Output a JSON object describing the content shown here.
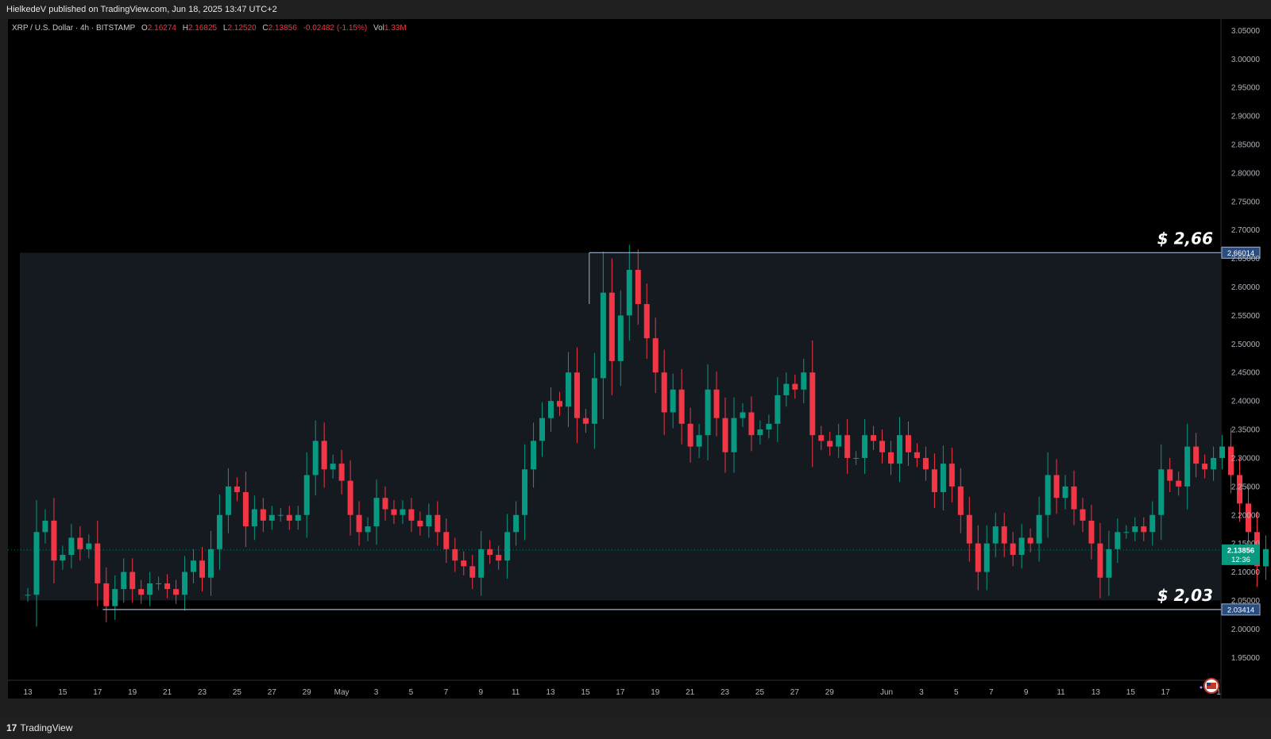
{
  "header": {
    "published": "HielkedeV published on TradingView.com, Jun 18, 2025 13:47 UTC+2"
  },
  "legend": {
    "symbol": "XRP / U.S. Dollar · 4h · BITSTAMP",
    "open_label": "O",
    "open": "2.16274",
    "high_label": "H",
    "high": "2.16825",
    "low_label": "L",
    "low": "2.12520",
    "close_label": "C",
    "close": "2.13856",
    "change": "-0.02482 (-1.15%)",
    "vol_label": "Vol",
    "vol": "1.33M"
  },
  "footer": {
    "logo_mark": "17",
    "logo_text": "TradingView"
  },
  "colors": {
    "up": "#089981",
    "down": "#f23645",
    "bg": "#000000",
    "zone": "#141a20",
    "level_line": "#9fb4cc",
    "accent_badge": "#2b4c7e",
    "price_badge": "#089981"
  },
  "chart_data": {
    "type": "candlestick",
    "interval": "4h",
    "ylim": [
      1.91,
      3.07
    ],
    "y_ticks": [
      "3.05000",
      "3.00000",
      "2.95000",
      "2.90000",
      "2.85000",
      "2.80000",
      "2.75000",
      "2.70000",
      "2.65000",
      "2.60000",
      "2.55000",
      "2.50000",
      "2.45000",
      "2.40000",
      "2.35000",
      "2.30000",
      "2.25000",
      "2.20000",
      "2.15000",
      "2.10000",
      "2.05000",
      "2.00000",
      "1.95000"
    ],
    "x_ticks": [
      "13",
      "15",
      "17",
      "19",
      "21",
      "23",
      "25",
      "27",
      "29",
      "May",
      "3",
      "5",
      "7",
      "9",
      "11",
      "13",
      "15",
      "17",
      "19",
      "21",
      "23",
      "25",
      "27",
      "29",
      "Jun",
      "3",
      "5",
      "7",
      "9",
      "11",
      "13",
      "15",
      "17",
      "1"
    ],
    "range_zone": {
      "top": 2.66,
      "bottom": 2.05,
      "from": "Apr 12",
      "to": "Jun 18"
    },
    "levels": [
      {
        "value": 2.66014,
        "label": "$ 2,66",
        "badge": "2.66014",
        "from": "May 12"
      },
      {
        "value": 2.03414,
        "label": "$ 2,03",
        "badge": "2.03414",
        "from": "Apr 16"
      }
    ],
    "last_price": {
      "value": 2.13856,
      "badge": "2.13856",
      "countdown": "12:36"
    },
    "series": [
      {
        "d": 0,
        "c": 2.06
      },
      {
        "d": 0.5,
        "c": 2.17
      },
      {
        "d": 1,
        "c": 2.19
      },
      {
        "d": 1.5,
        "c": 2.12
      },
      {
        "d": 2,
        "c": 2.13
      },
      {
        "d": 2.5,
        "c": 2.16
      },
      {
        "d": 3,
        "c": 2.14
      },
      {
        "d": 3.5,
        "c": 2.15
      },
      {
        "d": 4,
        "c": 2.08
      },
      {
        "d": 4.5,
        "c": 2.04
      },
      {
        "d": 5,
        "c": 2.07
      },
      {
        "d": 5.5,
        "c": 2.1
      },
      {
        "d": 6,
        "c": 2.07
      },
      {
        "d": 6.5,
        "c": 2.06
      },
      {
        "d": 7,
        "c": 2.08
      },
      {
        "d": 7.5,
        "c": 2.08
      },
      {
        "d": 8,
        "c": 2.07
      },
      {
        "d": 8.5,
        "c": 2.06
      },
      {
        "d": 9,
        "c": 2.1
      },
      {
        "d": 9.5,
        "c": 2.12
      },
      {
        "d": 10,
        "c": 2.09
      },
      {
        "d": 10.5,
        "c": 2.14
      },
      {
        "d": 11,
        "c": 2.2
      },
      {
        "d": 11.5,
        "c": 2.25
      },
      {
        "d": 12,
        "c": 2.24
      },
      {
        "d": 12.5,
        "c": 2.18
      },
      {
        "d": 13,
        "c": 2.21
      },
      {
        "d": 13.5,
        "c": 2.19
      },
      {
        "d": 14,
        "c": 2.2
      },
      {
        "d": 14.5,
        "c": 2.2
      },
      {
        "d": 15,
        "c": 2.19
      },
      {
        "d": 15.5,
        "c": 2.2
      },
      {
        "d": 16,
        "c": 2.27
      },
      {
        "d": 16.5,
        "c": 2.33
      },
      {
        "d": 17,
        "c": 2.28
      },
      {
        "d": 17.5,
        "c": 2.29
      },
      {
        "d": 18,
        "c": 2.26
      },
      {
        "d": 18.5,
        "c": 2.2
      },
      {
        "d": 19,
        "c": 2.17
      },
      {
        "d": 19.5,
        "c": 2.18
      },
      {
        "d": 20,
        "c": 2.23
      },
      {
        "d": 20.5,
        "c": 2.21
      },
      {
        "d": 21,
        "c": 2.2
      },
      {
        "d": 21.5,
        "c": 2.21
      },
      {
        "d": 22,
        "c": 2.19
      },
      {
        "d": 22.5,
        "c": 2.18
      },
      {
        "d": 23,
        "c": 2.2
      },
      {
        "d": 23.5,
        "c": 2.17
      },
      {
        "d": 24,
        "c": 2.14
      },
      {
        "d": 24.5,
        "c": 2.12
      },
      {
        "d": 25,
        "c": 2.11
      },
      {
        "d": 25.5,
        "c": 2.09
      },
      {
        "d": 26,
        "c": 2.14
      },
      {
        "d": 26.5,
        "c": 2.13
      },
      {
        "d": 27,
        "c": 2.12
      },
      {
        "d": 27.5,
        "c": 2.17
      },
      {
        "d": 28,
        "c": 2.2
      },
      {
        "d": 28.5,
        "c": 2.28
      },
      {
        "d": 29,
        "c": 2.33
      },
      {
        "d": 29.5,
        "c": 2.37
      },
      {
        "d": 30,
        "c": 2.4
      },
      {
        "d": 30.5,
        "c": 2.39
      },
      {
        "d": 31,
        "c": 2.45
      },
      {
        "d": 31.5,
        "c": 2.37
      },
      {
        "d": 32,
        "c": 2.36
      },
      {
        "d": 32.5,
        "c": 2.44
      },
      {
        "d": 33,
        "c": 2.59
      },
      {
        "d": 33.5,
        "c": 2.47
      },
      {
        "d": 34,
        "c": 2.55
      },
      {
        "d": 34.5,
        "c": 2.63
      },
      {
        "d": 35,
        "c": 2.57
      },
      {
        "d": 35.5,
        "c": 2.51
      },
      {
        "d": 36,
        "c": 2.45
      },
      {
        "d": 36.5,
        "c": 2.38
      },
      {
        "d": 37,
        "c": 2.42
      },
      {
        "d": 37.5,
        "c": 2.36
      },
      {
        "d": 38,
        "c": 2.32
      },
      {
        "d": 38.5,
        "c": 2.34
      },
      {
        "d": 39,
        "c": 2.42
      },
      {
        "d": 39.5,
        "c": 2.37
      },
      {
        "d": 40,
        "c": 2.31
      },
      {
        "d": 40.5,
        "c": 2.37
      },
      {
        "d": 41,
        "c": 2.38
      },
      {
        "d": 41.5,
        "c": 2.34
      },
      {
        "d": 42,
        "c": 2.35
      },
      {
        "d": 42.5,
        "c": 2.36
      },
      {
        "d": 43,
        "c": 2.41
      },
      {
        "d": 43.5,
        "c": 2.43
      },
      {
        "d": 44,
        "c": 2.42
      },
      {
        "d": 44.5,
        "c": 2.45
      },
      {
        "d": 45,
        "c": 2.34
      },
      {
        "d": 45.5,
        "c": 2.33
      },
      {
        "d": 46,
        "c": 2.32
      },
      {
        "d": 46.5,
        "c": 2.34
      },
      {
        "d": 47,
        "c": 2.3
      },
      {
        "d": 47.5,
        "c": 2.3
      },
      {
        "d": 48,
        "c": 2.34
      },
      {
        "d": 48.5,
        "c": 2.33
      },
      {
        "d": 49,
        "c": 2.31
      },
      {
        "d": 49.5,
        "c": 2.29
      },
      {
        "d": 50,
        "c": 2.34
      },
      {
        "d": 50.5,
        "c": 2.31
      },
      {
        "d": 51,
        "c": 2.3
      },
      {
        "d": 51.5,
        "c": 2.28
      },
      {
        "d": 52,
        "c": 2.24
      },
      {
        "d": 52.5,
        "c": 2.29
      },
      {
        "d": 53,
        "c": 2.25
      },
      {
        "d": 53.5,
        "c": 2.2
      },
      {
        "d": 54,
        "c": 2.15
      },
      {
        "d": 54.5,
        "c": 2.1
      },
      {
        "d": 55,
        "c": 2.15
      },
      {
        "d": 55.5,
        "c": 2.18
      },
      {
        "d": 56,
        "c": 2.15
      },
      {
        "d": 56.5,
        "c": 2.13
      },
      {
        "d": 57,
        "c": 2.16
      },
      {
        "d": 57.5,
        "c": 2.15
      },
      {
        "d": 58,
        "c": 2.2
      },
      {
        "d": 58.5,
        "c": 2.27
      },
      {
        "d": 59,
        "c": 2.23
      },
      {
        "d": 59.5,
        "c": 2.25
      },
      {
        "d": 60,
        "c": 2.21
      },
      {
        "d": 60.5,
        "c": 2.19
      },
      {
        "d": 61,
        "c": 2.15
      },
      {
        "d": 61.5,
        "c": 2.09
      },
      {
        "d": 62,
        "c": 2.14
      },
      {
        "d": 62.5,
        "c": 2.17
      },
      {
        "d": 63,
        "c": 2.17
      },
      {
        "d": 63.5,
        "c": 2.18
      },
      {
        "d": 64,
        "c": 2.17
      },
      {
        "d": 64.5,
        "c": 2.2
      },
      {
        "d": 65,
        "c": 2.28
      },
      {
        "d": 65.5,
        "c": 2.26
      },
      {
        "d": 66,
        "c": 2.25
      },
      {
        "d": 66.5,
        "c": 2.32
      },
      {
        "d": 67,
        "c": 2.29
      },
      {
        "d": 67.5,
        "c": 2.28
      },
      {
        "d": 68,
        "c": 2.3
      },
      {
        "d": 68.5,
        "c": 2.32
      },
      {
        "d": 69,
        "c": 2.27
      },
      {
        "d": 69.5,
        "c": 2.22
      },
      {
        "d": 70,
        "c": 2.17
      },
      {
        "d": 70.5,
        "c": 2.11
      },
      {
        "d": 71,
        "c": 2.14
      },
      {
        "d": 71.5,
        "c": 2.15
      },
      {
        "d": 72,
        "c": 2.16
      },
      {
        "d": 72.5,
        "c": 2.12
      },
      {
        "d": 73,
        "c": 2.15
      },
      {
        "d": 73.5,
        "c": 2.16
      },
      {
        "d": 74,
        "c": 2.25
      },
      {
        "d": 74.5,
        "c": 2.33
      },
      {
        "d": 75,
        "c": 2.22
      },
      {
        "d": 75.5,
        "c": 2.17
      },
      {
        "d": 76,
        "c": 2.14
      }
    ]
  }
}
